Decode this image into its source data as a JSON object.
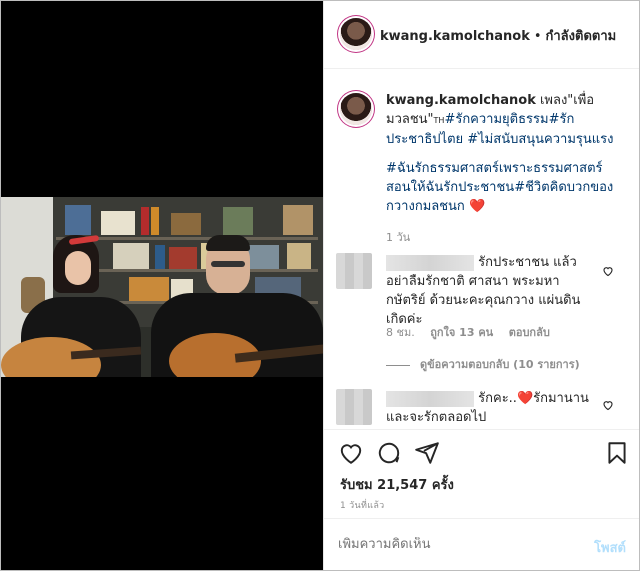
{
  "post": {
    "username": "kwang.kamolchanok",
    "separator": "•",
    "follow_status": "กำลังติดตาม",
    "caption_intro": "เพลง\"เพื่อมวลชน\"",
    "caption_small_tag": "TH",
    "caption_tags_1": "#รักความยุติธรรม#รักประชาธิปไตย #ไม่สนับสนุนความรุนแรง",
    "caption_tags_2": "#ฉันรักธรรมศาสตร์เพราะธรรมศาสตร์สอนให้ฉันรักประชาชน#ชีวิตคิดบวกของกวางกมลชนก",
    "caption_emoji": "❤️",
    "caption_time": "1 วัน"
  },
  "comments": [
    {
      "text": "รักประชาชน แล้วอย่าลืมรักชาติ ศาสนา พระมหากษัตริย์ ด้วยนะคะคุณกวาง แผ่นดินเกิดค่ะ",
      "time": "8 ชม.",
      "likes": "ถูกใจ 13 คน",
      "reply": "ตอบกลับ",
      "view_replies": "ดูข้อความตอบกลับ (10 รายการ)"
    },
    {
      "text_a": "รักคะ..",
      "emoji": "❤️",
      "text_b": "รักมานานและจะรักตลอดไป"
    }
  ],
  "actions": {
    "likes_text": "รับชม 21,547 ครั้ง",
    "time_ago": "1 วันที่แล้ว",
    "add_comment_placeholder": "เพิ่มความคิดเห็น",
    "post_label": "โพสต์"
  }
}
